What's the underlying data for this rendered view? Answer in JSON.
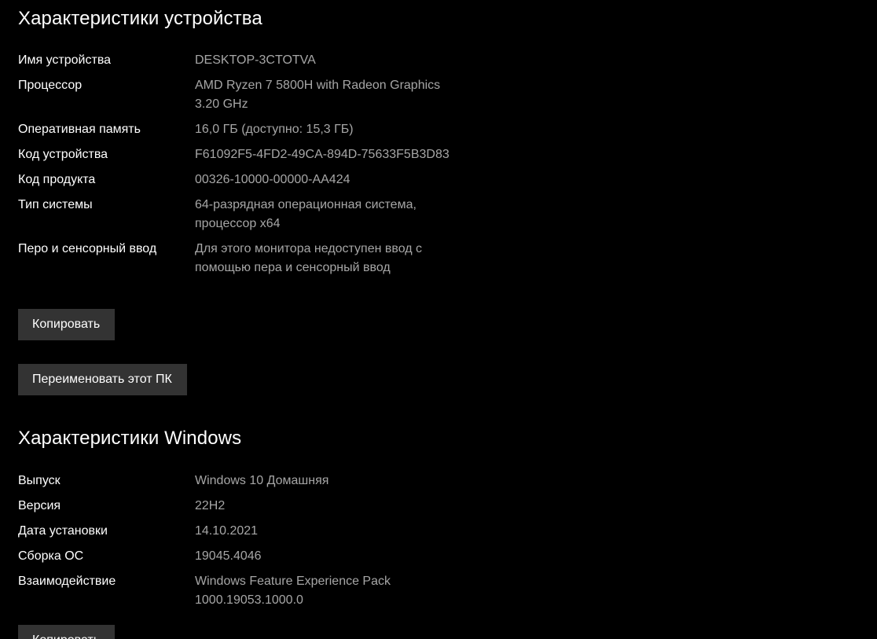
{
  "device_specs": {
    "title": "Характеристики устройства",
    "rows": [
      {
        "key": "Имя устройства",
        "value": "DESKTOP-3CTOTVA"
      },
      {
        "key": "Процессор",
        "value": "AMD Ryzen 7 5800H with Radeon Graphics 3.20 GHz"
      },
      {
        "key": "Оперативная память",
        "value": "16,0 ГБ (доступно: 15,3 ГБ)"
      },
      {
        "key": "Код устройства",
        "value": "F61092F5-4FD2-49CA-894D-75633F5B3D83"
      },
      {
        "key": "Код продукта",
        "value": "00326-10000-00000-AA424"
      },
      {
        "key": "Тип системы",
        "value": "64-разрядная операционная система, процессор x64"
      },
      {
        "key": "Перо и сенсорный ввод",
        "value": "Для этого монитора недоступен ввод с помощью пера и сенсорный ввод"
      }
    ],
    "copy_label": "Копировать",
    "rename_label": "Переименовать этот ПК"
  },
  "windows_specs": {
    "title": "Характеристики Windows",
    "rows": [
      {
        "key": "Выпуск",
        "value": "Windows 10 Домашняя"
      },
      {
        "key": "Версия",
        "value": "22H2"
      },
      {
        "key": "Дата установки",
        "value": "14.10.2021"
      },
      {
        "key": "Сборка ОС",
        "value": "19045.4046"
      },
      {
        "key": "Взаимодействие",
        "value": "Windows Feature Experience Pack 1000.19053.1000.0"
      }
    ],
    "copy_label": "Копировать"
  },
  "colors": {
    "background": "#000000",
    "text_primary": "#ffffff",
    "text_secondary": "#a6a6a6",
    "button_bg": "#333333"
  }
}
